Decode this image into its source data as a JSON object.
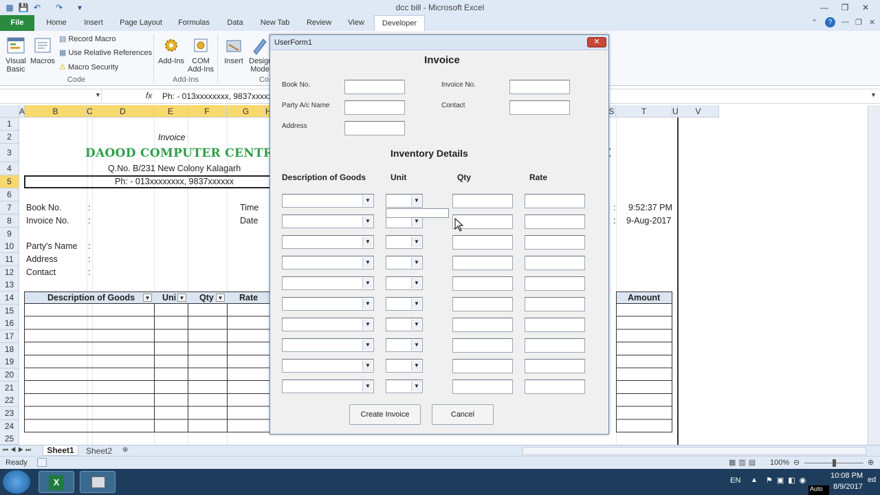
{
  "window": {
    "title": "dcc bill  -  Microsoft Excel"
  },
  "ribbon_tabs": [
    "File",
    "Home",
    "Insert",
    "Page Layout",
    "Formulas",
    "Data",
    "New Tab",
    "Review",
    "View",
    "Developer"
  ],
  "ribbon": {
    "code": {
      "visual_basic": "Visual Basic",
      "macros": "Macros",
      "record_macro": "Record Macro",
      "relative_refs": "Use Relative References",
      "macro_security": "Macro Security",
      "label": "Code"
    },
    "addins": {
      "addins": "Add-Ins",
      "com_addins": "COM Add-Ins",
      "label": "Add-Ins"
    },
    "controls": {
      "insert": "Insert",
      "design_mode": "Design Mode",
      "label": "Co"
    }
  },
  "formula_bar": {
    "fx": "fx",
    "content": "Ph: - 013xxxxxxxx,  9837xxxxxx"
  },
  "columns": [
    "A",
    "B",
    "C",
    "D",
    "E",
    "F",
    "G",
    "H",
    "S",
    "T",
    "U",
    "V"
  ],
  "rows": [
    "1",
    "2",
    "3",
    "4",
    "5",
    "6",
    "7",
    "8",
    "9",
    "10",
    "11",
    "12",
    "13",
    "14",
    "15",
    "16",
    "17",
    "18",
    "19",
    "20",
    "21",
    "22",
    "23",
    "24",
    "25"
  ],
  "sheet": {
    "invoice_heading": "Invoice",
    "company": "DAOOD COMPUTER CENTRE",
    "company_tail": "E",
    "address": "Q.No. B/231 New Colony Kalagarh",
    "phone": "Ph: - 013xxxxxxxx,  9837xxxxxx",
    "book_no": "Book No.",
    "invoice_no": "Invoice No.",
    "time_label": "Time",
    "date_label": "Date",
    "time_value": "9:52:37 PM",
    "date_value": "9-Aug-2017",
    "partys_name": "Party's Name",
    "address_label": "Address",
    "contact_label": "Contact",
    "colon": ":",
    "table_headers": {
      "description": "Description of Goods",
      "unit": "Uni",
      "qty": "Qty",
      "rate": "Rate",
      "amount": "Amount"
    }
  },
  "sheet_tabs": [
    "Sheet1",
    "Sheet2"
  ],
  "status": {
    "ready": "Ready",
    "zoom": "100%"
  },
  "taskbar": {
    "lang": "EN",
    "time": "10:08 PM",
    "date": "8/9/2017",
    "corner_text_1": "ed",
    "corner_text_2": "Auto"
  },
  "userform": {
    "title": "UserForm1",
    "close": "✕",
    "heading": "Invoice",
    "labels": {
      "book_no": "Book No.",
      "party": "Party A/c Name",
      "address": "Address",
      "invoice_no": "Invoice No.",
      "contact": "Contact"
    },
    "inventory_heading": "Inventory Details",
    "cols": {
      "description": "Description of Goods",
      "unit": "Unit",
      "qty": "Qty",
      "rate": "Rate"
    },
    "create_button": "Create Invoice",
    "cancel_button": "Cancel"
  }
}
